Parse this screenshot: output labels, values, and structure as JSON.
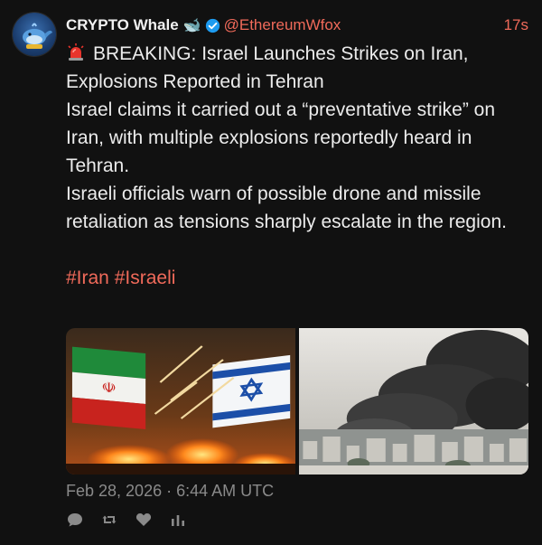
{
  "post": {
    "display_name": "CRYPTO Whale",
    "name_emoji": "🐋",
    "handle": "@EthereumWfox",
    "time_ago": "17s",
    "headline": "BREAKING: Israel Launches Strikes on Iran, Explosions Reported in Tehran",
    "paragraph_1": "Israel claims it carried out a “preventative strike” on Iran, with multiple explosions reportedly heard in Tehran.",
    "paragraph_2": "Israeli officials warn of possible drone and missile retaliation as tensions sharply escalate in the region.",
    "hashtags": [
      "#Iran",
      "#Israeli"
    ],
    "timestamp": "Feb 28, 2026 · 6:44 AM UTC"
  },
  "icons": {
    "alert": "rotating-light-icon",
    "verified": "verified-badge-icon",
    "reply": "reply-icon",
    "repost": "repost-icon",
    "like": "heart-icon",
    "stats": "stats-icon"
  },
  "colors": {
    "background": "#111111",
    "accent": "#f06a5a",
    "text": "#ececec",
    "muted": "#8a8a8a",
    "verified": "#1d9bf0"
  }
}
